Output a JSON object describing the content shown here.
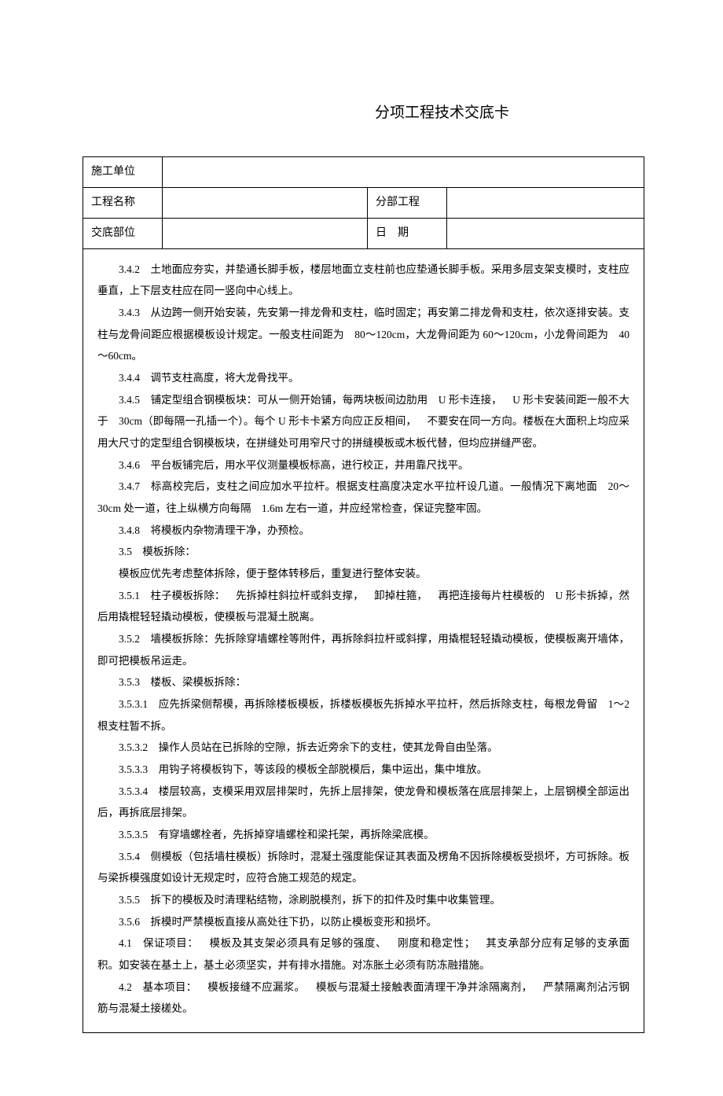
{
  "title": "分项工程技术交底卡",
  "header": {
    "row1_label": "施工单位",
    "row1_value": "",
    "row2_label": "工程名称",
    "row2_value": "",
    "row2_mid_label": "分部工程",
    "row2_mid_value": "",
    "row3_label": "交底部位",
    "row3_value": "",
    "row3_mid_label": "日 期",
    "row3_mid_value": ""
  },
  "body": {
    "p342": "3.4.2 土地面应夯实，并垫通长脚手板，楼层地面立支柱前也应垫通长脚手板。采用多层支架支模时，支柱应垂直，上下层支柱应在同一竖向中心线上。",
    "p343": "3.4.3 从边跨一侧开始安装，先安第一排龙骨和支柱，临时固定；再安第二排龙骨和支柱，依次逐排安装。支柱与龙骨间距应根据模板设计规定。一般支柱间距为 80～120cm，大龙骨间距为 60～120cm，小龙骨间距为 40～60cm。",
    "p344": "3.4.4 调节支柱高度，将大龙骨找平。",
    "p345": "3.4.5 铺定型组合钢模板块：可从一侧开始铺，每两块板间边肋用 U 形卡连接， U 形卡安装间距一般不大于 30cm（即每隔一孔插一个）。每个 U 形卡卡紧方向应正反相间， 不要安在同一方向。楼板在大面积上均应采用大尺寸的定型组合钢模板块，在拼缝处可用窄尺寸的拼缝模板或木板代替，但均应拼缝严密。",
    "p346": "3.4.6 平台板铺完后，用水平仪测量模板标高，进行校正，并用靠尺找平。",
    "p347": "3.4.7 标高校完后，支柱之间应加水平拉杆。根据支柱高度决定水平拉杆设几道。一般情况下离地面 20～30cm 处一道，往上纵横方向每隔 1.6m 左右一道，并应经常检查，保证完整牢固。",
    "p348": "3.4.8 将模板内杂物清理干净，办预检。",
    "p35": "3.5 模板拆除：",
    "p35a": "模板应优先考虑整体拆除，便于整体转移后，重复进行整体安装。",
    "p351": "3.5.1 柱子模板拆除： 先拆掉柱斜拉杆或斜支撑， 卸掉柱箍， 再把连接每片柱模板的 U 形卡拆掉，然后用撬棍轻轻撬动模板，使模板与混凝土脱离。",
    "p352": "3.5.2 墙模板拆除：先拆除穿墙螺栓等附件，再拆除斜拉杆或斜撑，用撬棍轻轻撬动模板，使模板离开墙体，即可把模板吊运走。",
    "p353": "3.5.3 楼板、梁模板拆除：",
    "p3531": "3.5.3.1 应先拆梁侧帮模，再拆除楼板模板，拆楼板模板先拆掉水平拉杆，然后拆除支柱，每根龙骨留 1～2 根支柱暂不拆。",
    "p3532": "3.5.3.2 操作人员站在已拆除的空隙，拆去近旁余下的支柱，使其龙骨自由坠落。",
    "p3533": "3.5.3.3 用钩子将模板钩下，等该段的模板全部脱模后，集中运出，集中堆放。",
    "p3534": "3.5.3.4 楼层较高，支模采用双层排架时，先拆上层排架，使龙骨和模板落在底层排架上，上层钢模全部运出后，再拆底层排架。",
    "p3535": "3.5.3.5 有穿墙螺栓者，先拆掉穿墙螺栓和梁托架，再拆除梁底模。",
    "p354": "3.5.4 侧模板（包括墙柱模板）拆除时，混凝土强度能保证其表面及楞角不因拆除模板受损坏，方可拆除。板与梁拆模强度如设计无规定时，应符合施工规范的规定。",
    "p355": "3.5.5 拆下的模板及时清理粘结物，涂刷脱模剂，拆下的扣件及时集中收集管理。",
    "p356": "3.5.6 拆模时严禁模板直接从高处往下扔，以防止模板变形和损坏。",
    "p41": "4.1 保证项目： 模板及其支架必须具有足够的强度、 刚度和稳定性； 其支承部分应有足够的支承面积。如安装在基土上，基土必须坚实，并有排水措施。对冻胀土必须有防冻融措施。",
    "p42": "4.2 基本项目： 模板接缝不应漏浆。 模板与混凝土接触表面清理干净并涂隔离剂， 严禁隔离剂沾污钢筋与混凝土接槎处。"
  }
}
